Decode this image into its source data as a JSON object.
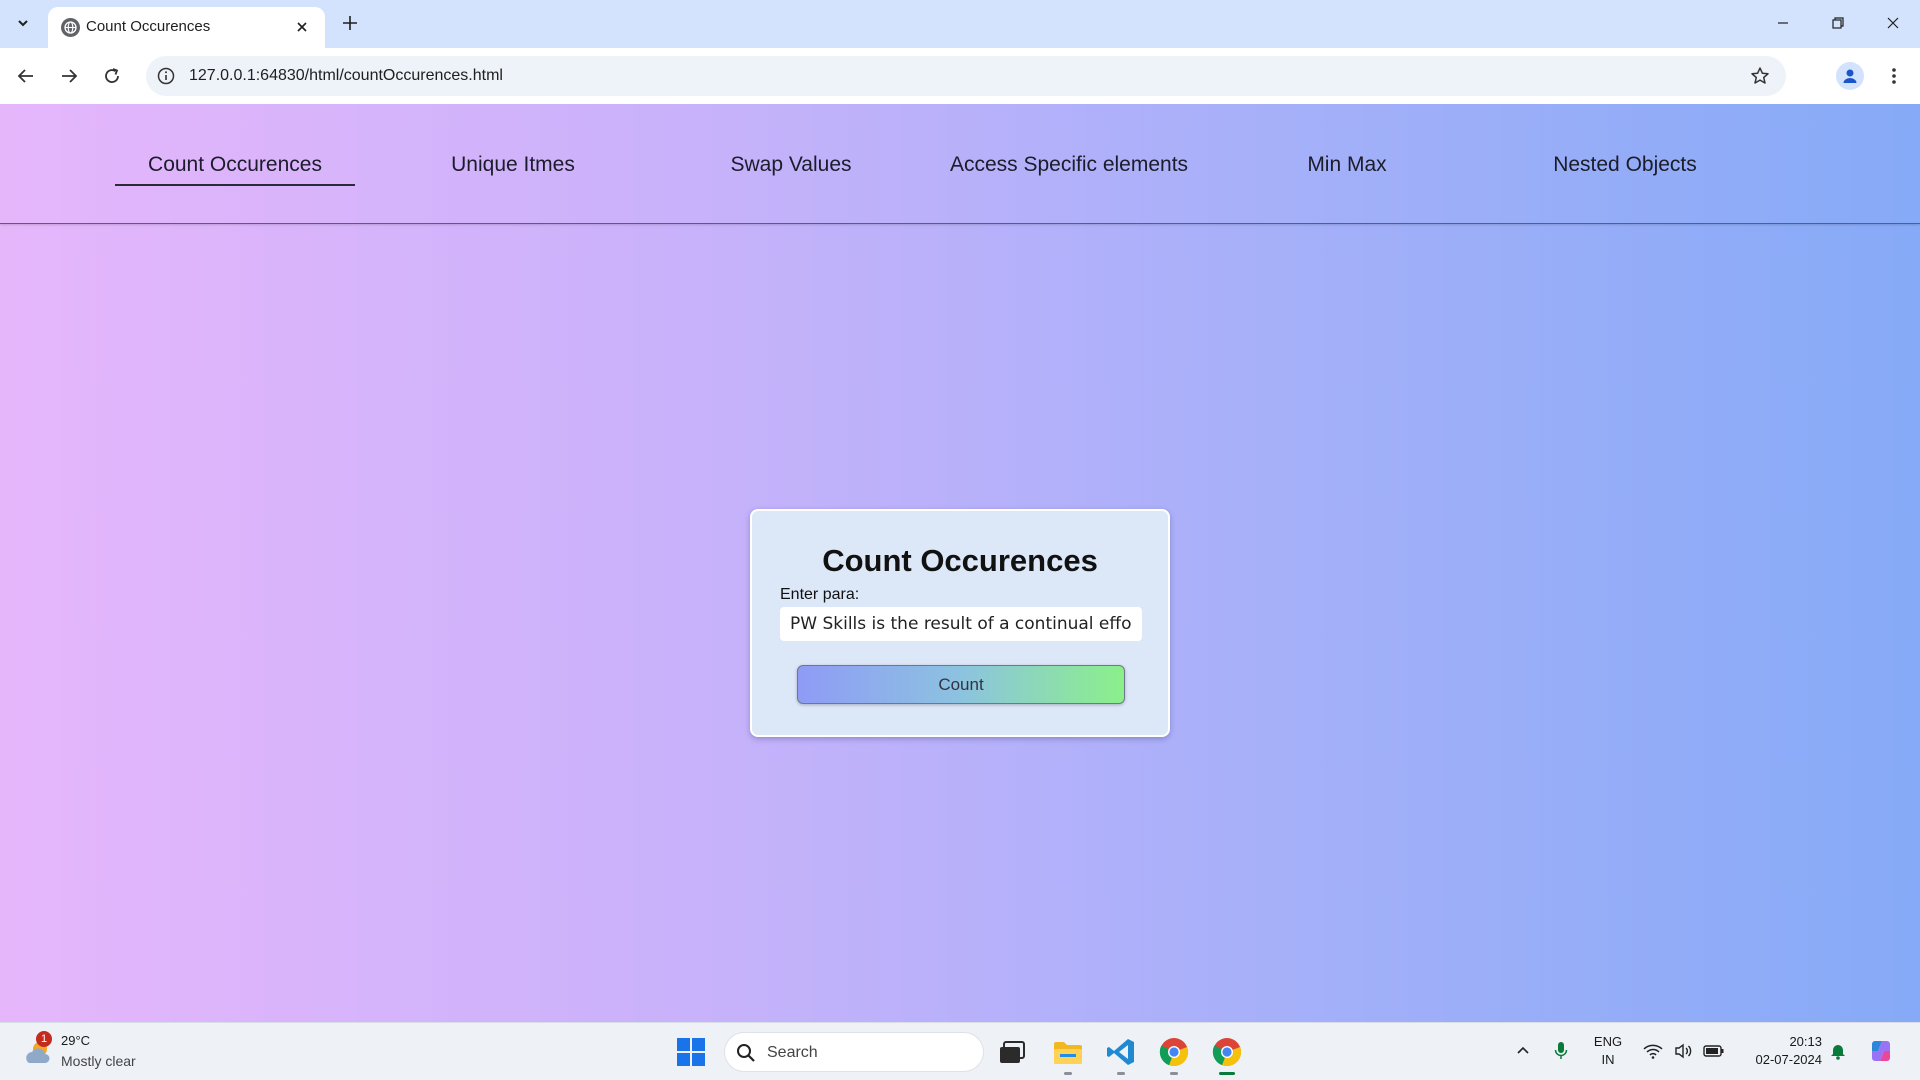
{
  "browser": {
    "tab_title": "Count Occurences",
    "url": "127.0.0.1:64830/html/countOccurences.html"
  },
  "nav": {
    "items": [
      {
        "label": "Count Occurences",
        "active": true
      },
      {
        "label": "Unique Itmes"
      },
      {
        "label": "Swap Values"
      },
      {
        "label": "Access Specific elements"
      },
      {
        "label": "Min Max"
      },
      {
        "label": "Nested Objects"
      }
    ]
  },
  "card": {
    "title": "Count Occurences",
    "input_label": "Enter para:",
    "input_value": "PW Skills is the result of a continual effort",
    "button_label": "Count"
  },
  "taskbar": {
    "weather": {
      "temp": "29°C",
      "condition": "Mostly clear",
      "badge": "1"
    },
    "search_placeholder": "Search",
    "language": {
      "line1": "ENG",
      "line2": "IN"
    },
    "clock": {
      "time": "20:13",
      "date": "02-07-2024"
    }
  },
  "colors": {
    "gradient_start": "#e6b6fb",
    "gradient_end": "#86aaf7",
    "button_gradient_start": "#8f9bf6",
    "button_gradient_end": "#8bf08a"
  }
}
